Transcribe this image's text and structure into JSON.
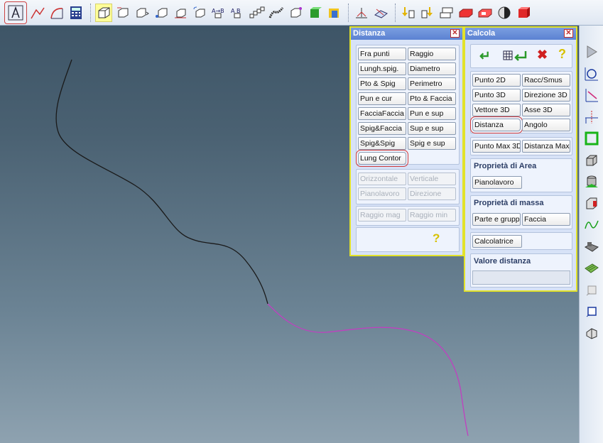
{
  "toolbar": {
    "icons": [
      "measure-icon",
      "polyline-icon",
      "curve-arc-icon",
      "calculator-icon",
      "box-icon",
      "box-dims-icon",
      "box-arrow-icon",
      "box-point-icon",
      "box-axis-icon",
      "box-rotate-icon",
      "arrow-ab-icon",
      "arrow-ab-2-icon",
      "chain-icon",
      "spring-icon",
      "box-corner-icon",
      "cube-green-icon",
      "cube-yellow-icon",
      "tripod-icon",
      "workplane-icon",
      "pin-down-icon",
      "pin-down-2-icon",
      "stack-box-icon",
      "red-box-icon",
      "red-box-2-icon",
      "sphere-half-icon",
      "red-cube-icon"
    ]
  },
  "vtoolbar": {
    "icons": [
      "play-icon",
      "circle-tool-icon",
      "line-tool-icon",
      "axis-tool-icon",
      "square-green-icon",
      "box-tool-icon",
      "cylinder-tool-icon",
      "shell-tool-icon",
      "wave-tool-icon",
      "blocks-tool-icon",
      "grid-tool-icon",
      "square-small-icon",
      "square-outline-icon",
      "bend-tool-icon"
    ]
  },
  "distanza": {
    "title": "Distanza",
    "buttons": [
      {
        "label": "Fra punti"
      },
      {
        "label": "Raggio"
      },
      {
        "label": "Lungh.spig."
      },
      {
        "label": "Diametro"
      },
      {
        "label": "Pto & Spig"
      },
      {
        "label": "Perimetro"
      },
      {
        "label": "Pun e cur"
      },
      {
        "label": "Pto & Faccia"
      },
      {
        "label": "FacciaFaccia"
      },
      {
        "label": "Pun e sup"
      },
      {
        "label": "Spig&Faccia"
      },
      {
        "label": "Sup e sup"
      },
      {
        "label": "Spig&Spig"
      },
      {
        "label": "Spig e sup"
      },
      {
        "label": "Lung Contor"
      }
    ],
    "disabled_buttons": [
      {
        "label": "Orizzontale"
      },
      {
        "label": "Verticale"
      },
      {
        "label": "Pianolavoro"
      },
      {
        "label": "Direzione"
      }
    ],
    "radius_buttons": [
      {
        "label": "Raggio mag"
      },
      {
        "label": "Raggio min"
      }
    ]
  },
  "calcola": {
    "title": "Calcola",
    "buttons": [
      {
        "label": "Punto 2D"
      },
      {
        "label": "Racc/Smus"
      },
      {
        "label": "Punto 3D"
      },
      {
        "label": "Direzione 3D"
      },
      {
        "label": "Vettore 3D"
      },
      {
        "label": "Asse 3D"
      },
      {
        "label": "Distanza"
      },
      {
        "label": "Angolo"
      }
    ],
    "max_buttons": [
      {
        "label": "Punto Max 3D"
      },
      {
        "label": "Distanza Max"
      }
    ],
    "area_heading": "Proprietà di Area",
    "area_button": "Pianolavoro",
    "mass_heading": "Proprietà di massa",
    "mass_buttons": [
      {
        "label": "Parte e gruppo"
      },
      {
        "label": "Faccia"
      }
    ],
    "calc_button": "Calcolatrice",
    "value_heading": "Valore distanza",
    "value": ""
  },
  "colors": {
    "curve_black": "#1a1a1a",
    "curve_magenta": "#c040c0",
    "panel_border": "#e2e22a",
    "highlight_circle": "#d03a3a"
  }
}
